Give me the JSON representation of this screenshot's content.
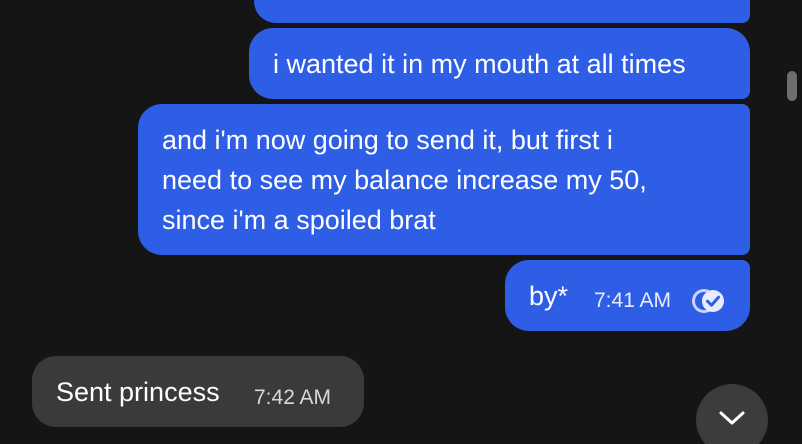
{
  "messages": [
    {
      "direction": "outgoing",
      "lines": [
        "i wanted it in my mouth at all times"
      ]
    },
    {
      "direction": "outgoing",
      "lines": [
        "and i'm now going to send it, but first i",
        "need to see my balance increase my 50,",
        "since i'm a spoiled brat"
      ]
    },
    {
      "direction": "outgoing",
      "text": "by*",
      "time": "7:41 AM",
      "status_icon": "read-double-check-icon"
    },
    {
      "direction": "incoming",
      "text": "Sent princess",
      "time": "7:42 AM"
    }
  ],
  "colors": {
    "background": "#151515",
    "outgoing_bubble": "#2f5ee6",
    "incoming_bubble": "#3a3a3a",
    "text": "#ffffff",
    "scroll_button": "#3c3c3c"
  },
  "scroll_button_icon": "chevron-down-icon"
}
